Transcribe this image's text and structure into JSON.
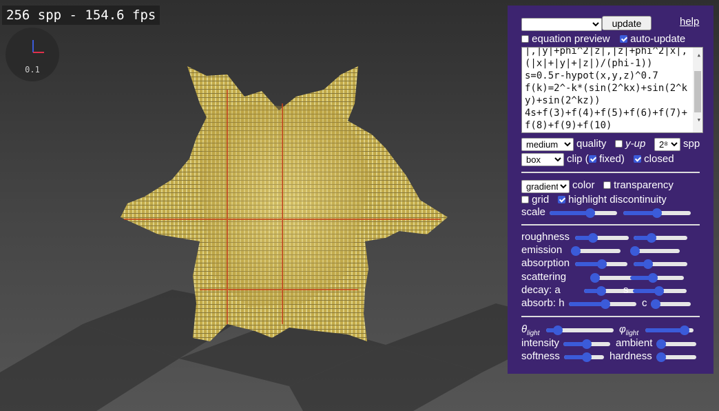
{
  "hud": {
    "fps_text": "256 spp - 154.6 fps",
    "axes_scale": "0.1"
  },
  "panel": {
    "preset_value": "",
    "update_label": "update",
    "help_label": "help",
    "equation_preview": {
      "label": "equation preview",
      "checked": false
    },
    "auto_update": {
      "label": "auto-update",
      "checked": true
    },
    "equation_text": "|,|y|+phi^2|z|,|z|+phi^2|x|,(|x|+|y|+|z|)/(phi-1))\ns=0.5r-hypot(x,y,z)^0.7\nf(k)=2^-k*(sin(2^kx)+sin(2^ky)+sin(2^kz))\n4s+f(3)+f(4)+f(5)+f(6)+f(7)+f(8)+f(9)+f(10)",
    "quality_select": "medium",
    "quality_label": "quality",
    "y_up": {
      "label": "y-up",
      "checked": false
    },
    "spp_select": "2⁸",
    "spp_label": "spp",
    "clip_select": "box",
    "clip_label": "clip (",
    "fixed": {
      "label": "fixed)",
      "checked": true
    },
    "closed": {
      "label": "closed",
      "checked": true
    },
    "color_select": "gradient",
    "color_label": "color",
    "transparency": {
      "label": "transparency",
      "checked": false
    },
    "grid": {
      "label": "grid",
      "checked": false
    },
    "highlight": {
      "label": "highlight discontinuity",
      "checked": true
    },
    "scale_label": "scale",
    "scale_sliders": [
      0.62,
      0.5
    ],
    "material": [
      {
        "label": "roughness",
        "a": 0.3,
        "b": 0.3
      },
      {
        "label": "emission",
        "a": 0.0,
        "b": 0.0
      },
      {
        "label": "absorption",
        "a": 0.52,
        "b": 0.22
      },
      {
        "label": "scattering",
        "a": 0.0,
        "b": 0.4
      }
    ],
    "decay_a_label": "decay: a",
    "decay_a": 0.28,
    "decay_s_label": "s",
    "decay_s": 0.48,
    "absorb_h_label": "absorb: h",
    "absorb_h": 0.55,
    "absorb_c_label": "c",
    "absorb_c": 0.0,
    "theta_label": "θ",
    "theta_sub": "light",
    "theta": 0.12,
    "phi_label": "φ",
    "phi_sub": "light",
    "phi": 0.9,
    "intensity_label": "intensity",
    "intensity": 0.5,
    "ambient_label": "ambient",
    "ambient": 0.0,
    "softness_label": "softness",
    "softness": 0.6,
    "hardness_label": "hardness",
    "hardness": 0.0
  }
}
